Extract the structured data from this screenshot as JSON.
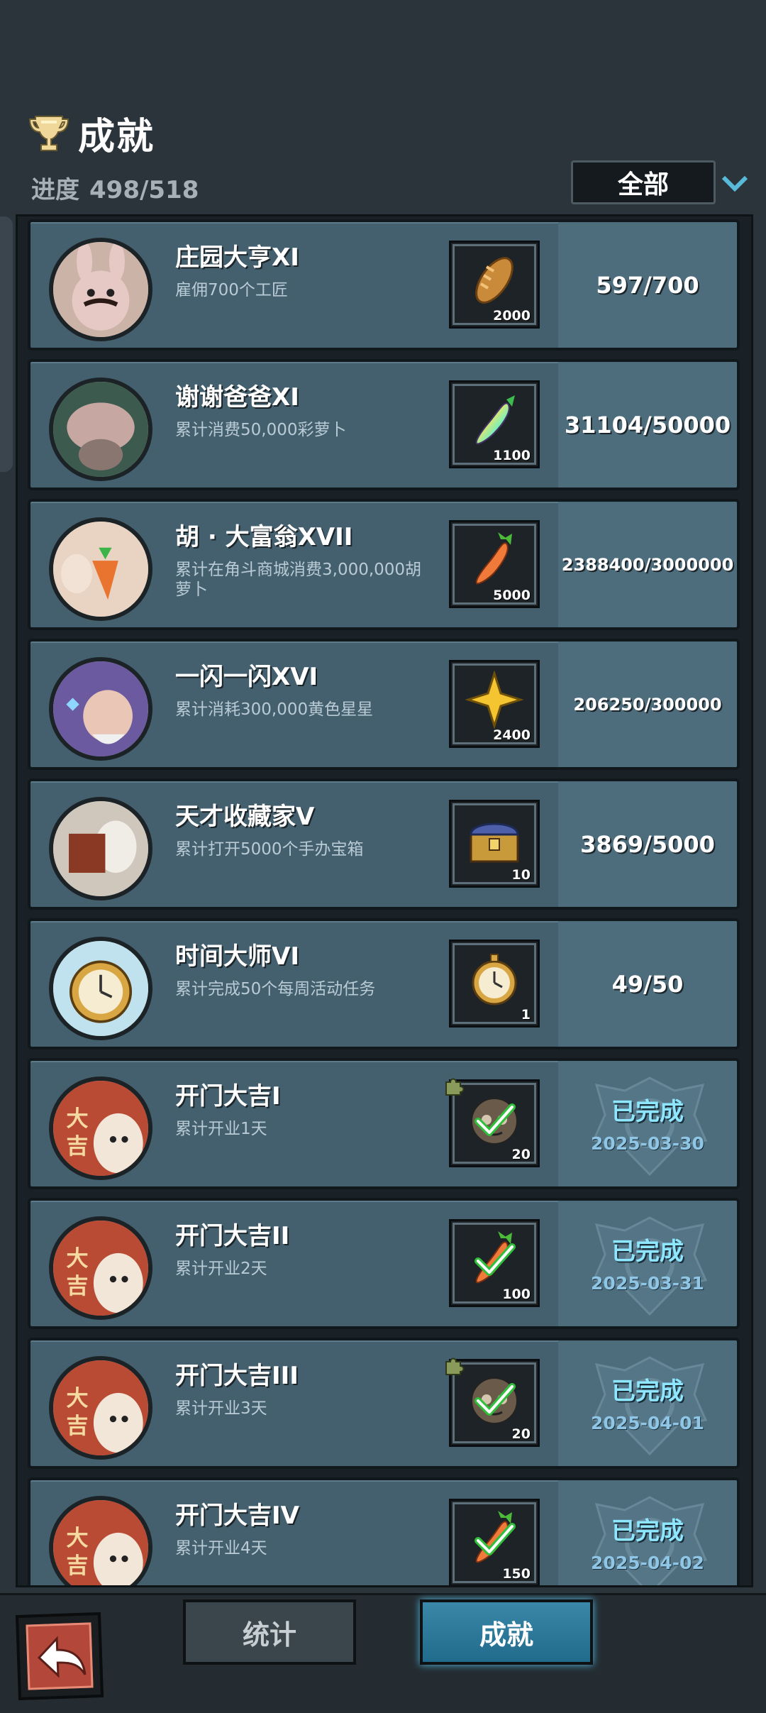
{
  "header": {
    "title": "成就",
    "progress_label": "进度",
    "progress_value": "498/518",
    "filter_label": "全部"
  },
  "achievements": [
    {
      "title": "庄园大亨XI",
      "desc": "雇佣700个工匠",
      "reward_icon": "bread-icon",
      "reward_count": "2000",
      "progress": "597/700",
      "avatar": "rabbit-chef-avatar"
    },
    {
      "title": "谢谢爸爸XI",
      "desc": "累计消费50,000彩萝卜",
      "reward_icon": "rainbow-carrot-icon",
      "reward_count": "1100",
      "progress": "31104/50000",
      "avatar": "pig-avatar"
    },
    {
      "title": "胡 · 大富翁XVII",
      "desc": "累计在角斗商城消费3,000,000胡萝卜",
      "reward_icon": "carrot-icon",
      "reward_count": "5000",
      "progress": "2388400/3000000",
      "avatar": "carrot-bunny-avatar"
    },
    {
      "title": "一闪一闪XVI",
      "desc": "累计消耗300,000黄色星星",
      "reward_icon": "gold-star-icon",
      "reward_count": "2400",
      "progress": "206250/300000",
      "avatar": "wizard-avatar"
    },
    {
      "title": "天才收藏家V",
      "desc": "累计打开5000个手办宝箱",
      "reward_icon": "treasure-chest-icon",
      "reward_count": "10",
      "progress": "3869/5000",
      "avatar": "collector-avatar"
    },
    {
      "title": "时间大师VI",
      "desc": "累计完成50个每周活动任务",
      "reward_icon": "pocket-watch-icon",
      "reward_count": "1",
      "progress": "49/50",
      "avatar": "pocket-watch-avatar"
    },
    {
      "title": "开门大吉I",
      "desc": "累计开业1天",
      "reward_icon": "figure-head-icon",
      "reward_count": "20",
      "status": "已完成",
      "date": "2025-03-30",
      "avatar": "daji-avatar"
    },
    {
      "title": "开门大吉II",
      "desc": "累计开业2天",
      "reward_icon": "carrot-icon",
      "reward_count": "100",
      "status": "已完成",
      "date": "2025-03-31",
      "avatar": "daji-avatar"
    },
    {
      "title": "开门大吉III",
      "desc": "累计开业3天",
      "reward_icon": "figure-head-icon",
      "reward_count": "20",
      "status": "已完成",
      "date": "2025-04-01",
      "avatar": "daji-avatar"
    },
    {
      "title": "开门大吉IV",
      "desc": "累计开业4天",
      "reward_icon": "carrot-icon",
      "reward_count": "150",
      "status": "已完成",
      "date": "2025-04-02",
      "avatar": "daji-avatar"
    }
  ],
  "footer": {
    "tab_stats": "统计",
    "tab_achievements": "成就"
  }
}
